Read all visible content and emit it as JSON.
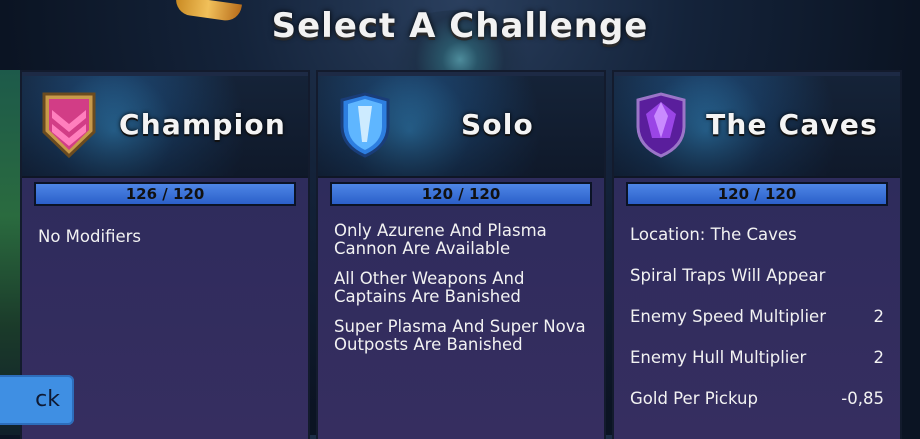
{
  "title": "Select A Challenge",
  "back_label": "ck",
  "colors": {
    "bar_fill": "#3f78dc",
    "panel": "#302c5d",
    "back": "#3f8fe3"
  },
  "cards": [
    {
      "name": "Champion",
      "badge_icon": "pink-chevron-badge-icon",
      "progress_text": "126 / 120",
      "progress_fraction": 1.0,
      "modifiers": [
        "No Modifiers"
      ]
    },
    {
      "name": "Solo",
      "badge_icon": "blue-crystal-shield-icon",
      "progress_text": "120 / 120",
      "progress_fraction": 1.0,
      "modifiers": [
        "Only Azurene And Plasma Cannon Are Available",
        "All Other Weapons And Captains Are Banished",
        "Super Plasma And Super Nova Outposts Are Banished"
      ]
    },
    {
      "name": "The Caves",
      "badge_icon": "purple-gem-shield-icon",
      "progress_text": "120 / 120",
      "progress_fraction": 1.0,
      "rows": [
        {
          "label": "Location: The Caves",
          "value": ""
        },
        {
          "label": "Spiral Traps Will Appear",
          "value": ""
        },
        {
          "label": "Enemy Speed Multiplier",
          "value": "2"
        },
        {
          "label": "Enemy Hull Multiplier",
          "value": "2"
        },
        {
          "label": "Gold Per Pickup",
          "value": "-0,85"
        }
      ]
    }
  ]
}
